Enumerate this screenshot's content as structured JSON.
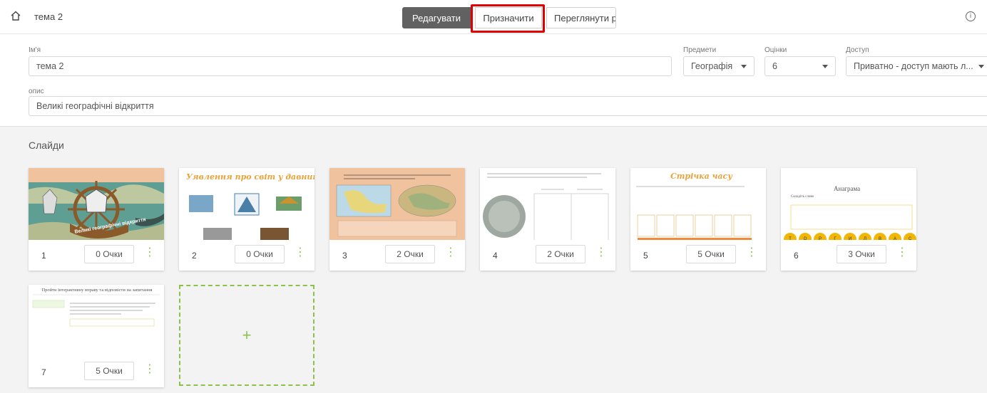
{
  "header": {
    "title": "тема 2",
    "tabs": [
      {
        "label": "Редагувати",
        "active": true
      },
      {
        "label": "Призначити",
        "active": false
      },
      {
        "label": "Переглянути рс",
        "active": false
      }
    ],
    "info_icon": "info-icon",
    "home_icon": "home-icon"
  },
  "form": {
    "name_label": "Ім'я",
    "name_value": "тема 2",
    "subjects_label": "Предмети",
    "subjects_value": "Географія",
    "grades_label": "Оцінки",
    "grades_value": "6",
    "access_label": "Доступ",
    "access_value": "Приватно - доступ мають л...",
    "desc_label": "опис",
    "desc_value": "Великі географічні відкриття"
  },
  "slides_section": {
    "title": "Слайди",
    "add_label": "+",
    "slides": [
      {
        "number": "1",
        "points": "0 Очки",
        "caption": "Великі географічні відкриття"
      },
      {
        "number": "2",
        "points": "0 Очки",
        "caption": "Уявлення про світ у давнину"
      },
      {
        "number": "3",
        "points": "2 Очки",
        "caption": ""
      },
      {
        "number": "4",
        "points": "2 Очки",
        "caption": ""
      },
      {
        "number": "5",
        "points": "5 Очки",
        "caption": "Стрічка часу"
      },
      {
        "number": "6",
        "points": "3 Очки",
        "caption": "Анаграма",
        "subcaption": "Складіть слово",
        "letters": [
          "Т",
          "О",
          "Р",
          "Г",
          "И",
          "Л",
          "В",
          "А",
          "С"
        ]
      },
      {
        "number": "7",
        "points": "5 Очки",
        "caption": "Пройти інтерактивну вправу та відповісти на запитання"
      }
    ]
  },
  "colors": {
    "accent": "#8bc34a",
    "active_tab": "#616161",
    "highlight": "#e00000",
    "thumb_peach": "#f0c29e"
  }
}
